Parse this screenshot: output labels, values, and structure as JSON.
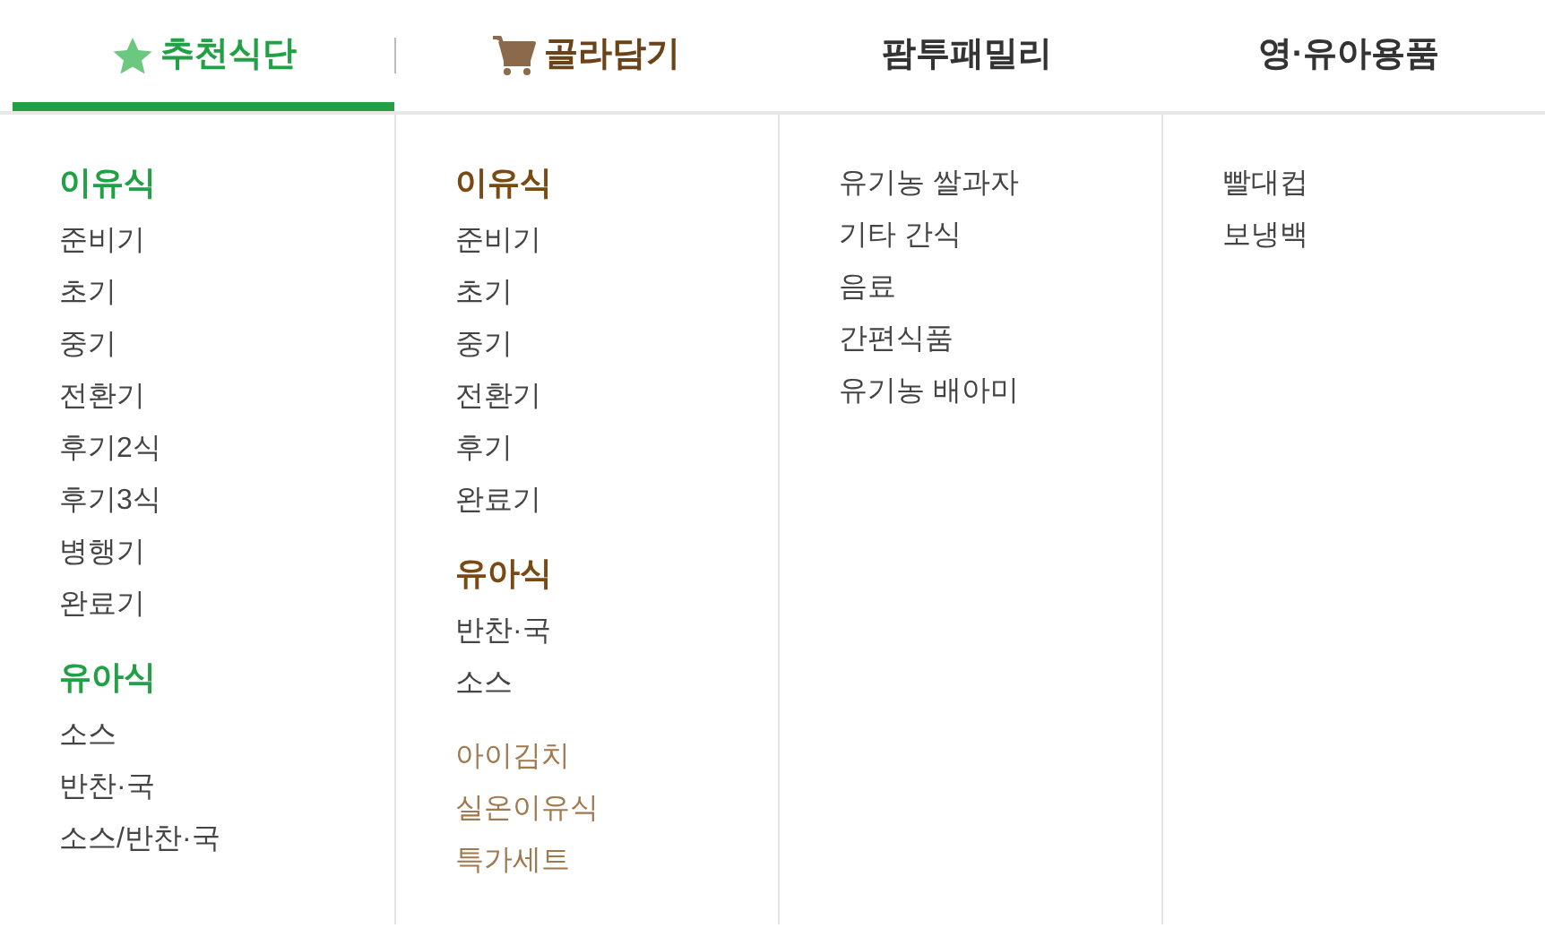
{
  "tabs": [
    {
      "label": "추천식단",
      "kind": "star",
      "selected": true
    },
    {
      "label": "골라담기",
      "kind": "cart",
      "selected": false
    },
    {
      "label": "팜투패밀리",
      "kind": "plain",
      "selected": false
    },
    {
      "label": "영·유아용품",
      "kind": "plain",
      "selected": false
    }
  ],
  "columns": [
    {
      "groups": [
        {
          "heading": "이유식",
          "color": "#22a045",
          "kind": "normal",
          "items": [
            "준비기",
            "초기",
            "중기",
            "전환기",
            "후기2식",
            "후기3식",
            "병행기",
            "완료기"
          ]
        },
        {
          "heading": "유아식",
          "color": "#22a045",
          "kind": "normal",
          "items": [
            "소스",
            "반찬·국",
            "소스/반찬·국"
          ]
        }
      ]
    },
    {
      "groups": [
        {
          "heading": "이유식",
          "color": "#7a4a14",
          "kind": "normal",
          "items": [
            "준비기",
            "초기",
            "중기",
            "전환기",
            "후기",
            "완료기"
          ]
        },
        {
          "heading": "유아식",
          "color": "#7a4a14",
          "kind": "normal",
          "items": [
            "반찬·국",
            "소스"
          ]
        },
        {
          "kind": "special",
          "items": [
            "아이김치",
            "실온이유식",
            "특가세트"
          ]
        }
      ]
    },
    {
      "groups": [
        {
          "kind": "normal",
          "items": [
            "유기농 쌀과자",
            "기타 간식",
            "음료",
            "간편식품",
            "유기농 배아미"
          ]
        }
      ]
    },
    {
      "groups": [
        {
          "kind": "normal",
          "items": [
            "빨대컵",
            "보냉백"
          ]
        }
      ]
    }
  ]
}
